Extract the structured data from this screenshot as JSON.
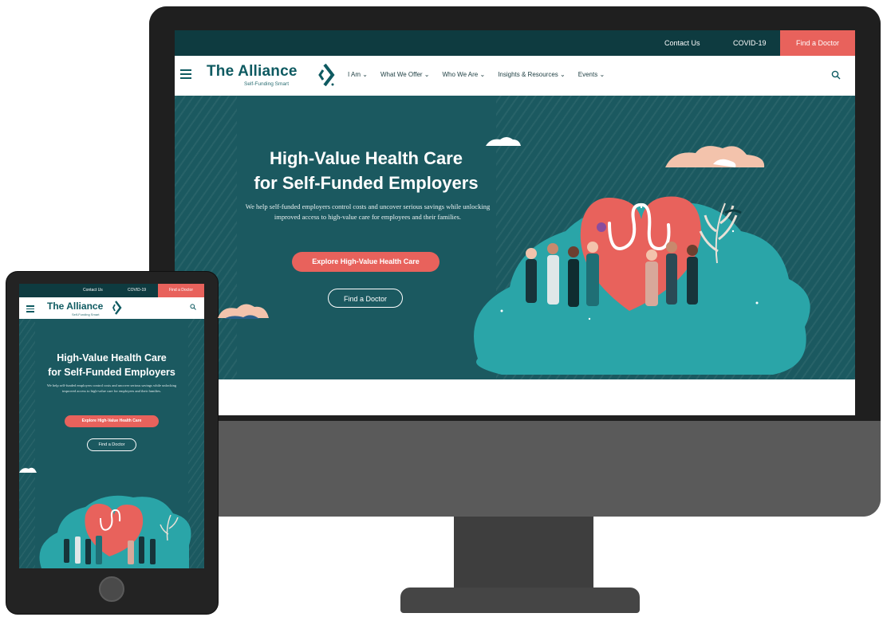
{
  "desktop": {
    "utility_nav": {
      "contact": "Contact Us",
      "covid": "COVID-19",
      "find_doctor": "Find a Doctor"
    },
    "logo": {
      "name": "The Alliance",
      "tagline": "Self-Funding Smart"
    },
    "menu": [
      {
        "label": "I Am"
      },
      {
        "label": "What We Offer"
      },
      {
        "label": "Who We Are"
      },
      {
        "label": "Insights & Resources"
      },
      {
        "label": "Events"
      }
    ],
    "hero": {
      "title_line1": "High-Value Health Care",
      "title_line2": "for Self-Funded Employers",
      "body": "We help self-funded employers control costs and uncover serious savings while unlocking improved access to high-value care for employees and their families.",
      "cta_primary": "Explore High-Value Health Care",
      "cta_secondary": "Find a Doctor"
    }
  },
  "mobile": {
    "utility_nav": {
      "contact": "Contact Us",
      "covid": "COVID-19",
      "find_doctor": "Find a Doctor"
    },
    "logo": {
      "name": "The Alliance",
      "tagline": "Self-Funding Smart"
    },
    "hero": {
      "title_line1": "High-Value Health Care",
      "title_line2": "for Self-Funded Employers",
      "body": "We help self-funded employers control costs and uncover serious savings while unlocking improved access to high-value care for employees and their families.",
      "cta_primary": "Explore High-Value Health Care",
      "cta_secondary": "Find a Doctor"
    }
  },
  "icons": {
    "menu": "hamburger-menu-icon",
    "search": "search-icon",
    "chevron": "chevron-down-icon",
    "logo_mark": "alliance-chevron-mark-icon"
  },
  "colors": {
    "teal_dark": "#0e3b40",
    "teal": "#1b5960",
    "brand_teal": "#0e5a61",
    "coral": "#e8625c",
    "peach": "#f3c3ac",
    "aqua": "#2aa5a8"
  }
}
